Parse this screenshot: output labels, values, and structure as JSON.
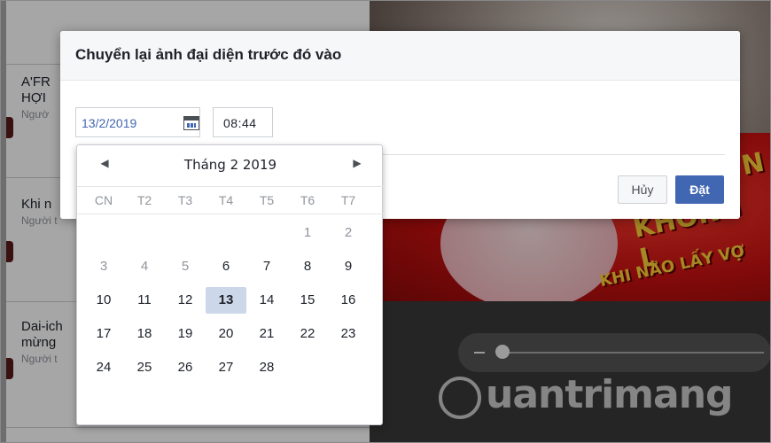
{
  "background": {
    "feed_items": [
      {
        "line1": "A'FR",
        "line2": "HỢI",
        "meta": "Ngườ"
      },
      {
        "line1": "Khi n",
        "line2": "",
        "meta": "Người t"
      },
      {
        "line1": "Dai-ich",
        "line2": "mừng",
        "meta": "Người t"
      }
    ],
    "banner_line1": "N",
    "banner_line2": "KHÔNG L",
    "banner_line3": "KHI NÀO LẤY VỢ",
    "watermark": "uantrimang"
  },
  "dialog": {
    "title": "Chuyển lại ảnh đại diện trước đó vào",
    "date_value": "13/2/2019",
    "time_value": "08:44",
    "cancel_label": "Hủy",
    "set_label": "Đặt",
    "accent": "#4267b2"
  },
  "calendar": {
    "prev_arrow": "◀",
    "next_arrow": "▶",
    "month_label": "Tháng 2 2019",
    "weekdays": [
      "CN",
      "T2",
      "T3",
      "T4",
      "T5",
      "T6",
      "T7"
    ],
    "selected_day": "13",
    "days": [
      {
        "label": "1",
        "col": 5,
        "row": 0,
        "dim": true
      },
      {
        "label": "2",
        "col": 6,
        "row": 0,
        "dim": true
      },
      {
        "label": "3",
        "col": 0,
        "row": 1,
        "dim": true
      },
      {
        "label": "4",
        "col": 1,
        "row": 1,
        "dim": true
      },
      {
        "label": "5",
        "col": 2,
        "row": 1,
        "dim": true
      },
      {
        "label": "6",
        "col": 3,
        "row": 1,
        "dim": false
      },
      {
        "label": "7",
        "col": 4,
        "row": 1,
        "dim": false
      },
      {
        "label": "8",
        "col": 5,
        "row": 1,
        "dim": false
      },
      {
        "label": "9",
        "col": 6,
        "row": 1,
        "dim": false
      },
      {
        "label": "10",
        "col": 0,
        "row": 2,
        "dim": false
      },
      {
        "label": "11",
        "col": 1,
        "row": 2,
        "dim": false
      },
      {
        "label": "12",
        "col": 2,
        "row": 2,
        "dim": false
      },
      {
        "label": "13",
        "col": 3,
        "row": 2,
        "dim": false
      },
      {
        "label": "14",
        "col": 4,
        "row": 2,
        "dim": false
      },
      {
        "label": "15",
        "col": 5,
        "row": 2,
        "dim": false
      },
      {
        "label": "16",
        "col": 6,
        "row": 2,
        "dim": false
      },
      {
        "label": "17",
        "col": 0,
        "row": 3,
        "dim": false
      },
      {
        "label": "18",
        "col": 1,
        "row": 3,
        "dim": false
      },
      {
        "label": "19",
        "col": 2,
        "row": 3,
        "dim": false
      },
      {
        "label": "20",
        "col": 3,
        "row": 3,
        "dim": false
      },
      {
        "label": "21",
        "col": 4,
        "row": 3,
        "dim": false
      },
      {
        "label": "22",
        "col": 5,
        "row": 3,
        "dim": false
      },
      {
        "label": "23",
        "col": 6,
        "row": 3,
        "dim": false
      },
      {
        "label": "24",
        "col": 0,
        "row": 4,
        "dim": false
      },
      {
        "label": "25",
        "col": 1,
        "row": 4,
        "dim": false
      },
      {
        "label": "26",
        "col": 2,
        "row": 4,
        "dim": false
      },
      {
        "label": "27",
        "col": 3,
        "row": 4,
        "dim": false
      },
      {
        "label": "28",
        "col": 4,
        "row": 4,
        "dim": false
      }
    ]
  }
}
